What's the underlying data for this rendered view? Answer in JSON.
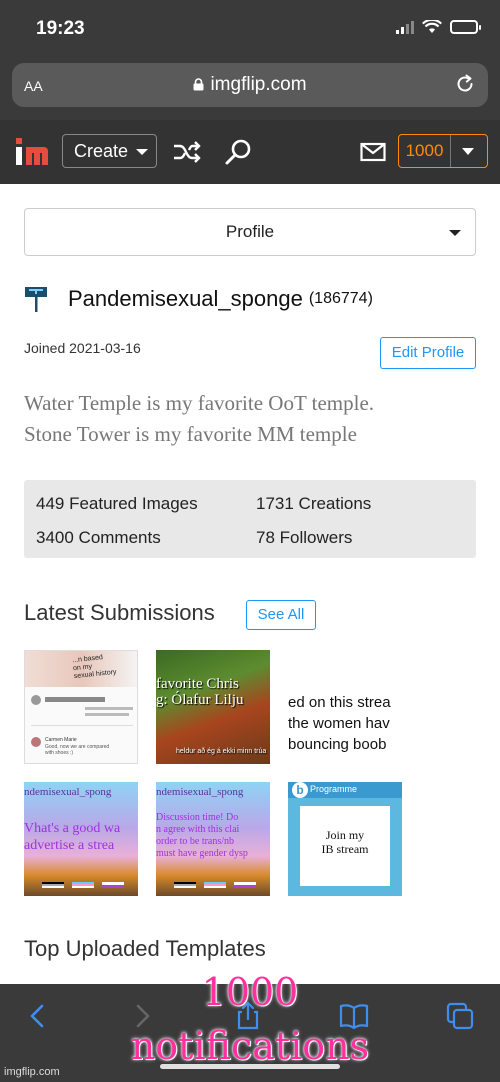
{
  "status": {
    "time": "19:23"
  },
  "browser": {
    "aa_label": "AA",
    "url": "imgflip.com"
  },
  "nav": {
    "logo": "im",
    "create_label": "Create",
    "notification_count": "1000"
  },
  "profile": {
    "select_label": "Profile",
    "username": "Pandemisexual_sponge",
    "points": "(186774)",
    "joined": "Joined 2021-03-16",
    "edit_label": "Edit Profile",
    "bio": [
      "Water Temple is my favorite OoT temple.",
      "Stone Tower is my favorite MM temple"
    ]
  },
  "stats": {
    "featured": "449 Featured Images",
    "creations": "1731 Creations",
    "comments": "3400 Comments",
    "followers": "78 Followers"
  },
  "latest": {
    "title": "Latest Submissions",
    "see_all": "See All",
    "thumbs": {
      "t1": {
        "lines": [
          "...n based",
          "on my",
          "sexual history"
        ],
        "comment_author": "Carmen Marie",
        "comment": "Good, now we are compared with shoes :)"
      },
      "t2": {
        "lines": [
          "favorite Chris",
          "g: Ólafur Lilju",
          "heldur að ég á ekki minn trúa"
        ]
      },
      "t3": {
        "lines": [
          "ed on this strea",
          "the women hav",
          "bouncing boob"
        ]
      },
      "t4": {
        "header": "ndemisexual_spong",
        "lines": [
          "Vhat's a good wa",
          "advertise a strea"
        ]
      },
      "t5": {
        "header": "ndemisexual_spong",
        "lines": [
          "Discussion time! Do",
          "n agree with this clai",
          "order to be trans/nb",
          "must have gender dysp"
        ]
      },
      "t6": {
        "header": "Programme",
        "badge": "b",
        "lines": [
          "Join my",
          "IB stream"
        ]
      }
    }
  },
  "templates": {
    "title": "Top Uploaded Templates"
  },
  "overlay": {
    "line1": "1000",
    "line2": "notifications"
  },
  "watermark": "imgflip.com",
  "colors": {
    "accent_blue": "#2196f3",
    "notif_orange": "#ff8c00",
    "overlay_pink": "#ff2f9e",
    "logo_red": "#e74c3c"
  }
}
